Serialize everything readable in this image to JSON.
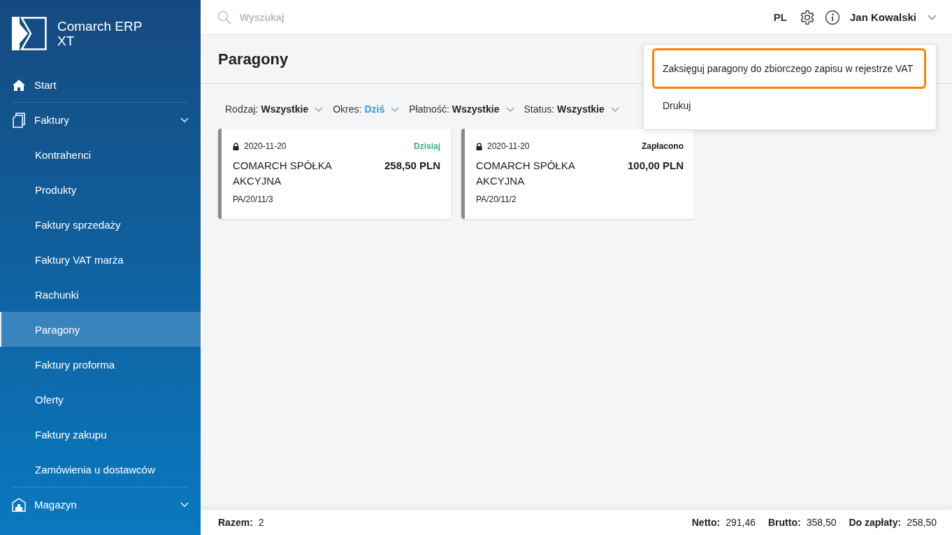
{
  "app": {
    "name_line_1": "Comarch ERP",
    "name_line_2": "XT"
  },
  "sidebar": {
    "items": [
      {
        "kind": "link",
        "label": "Start",
        "selected": false
      },
      {
        "kind": "group",
        "label": "Faktury",
        "expanded": true,
        "children": [
          {
            "label": "Kontrahenci",
            "selected": false
          },
          {
            "label": "Produkty",
            "selected": false
          },
          {
            "label": "Faktury sprzedaży",
            "selected": false
          },
          {
            "label": "Faktury VAT marża",
            "selected": false
          },
          {
            "label": "Rachunki",
            "selected": false
          },
          {
            "label": "Paragony",
            "selected": true
          },
          {
            "label": "Faktury proforma",
            "selected": false
          },
          {
            "label": "Oferty",
            "selected": false
          },
          {
            "label": "Faktury zakupu",
            "selected": false
          },
          {
            "label": "Zamówienia u dostawców",
            "selected": false
          }
        ]
      },
      {
        "kind": "group",
        "label": "Magazyn",
        "expanded": false
      }
    ]
  },
  "topbar": {
    "search": {
      "placeholder": "Wyszukaj"
    },
    "language": "PL",
    "user": "Jan Kowalski"
  },
  "page": {
    "title": "Paragony"
  },
  "filters": [
    {
      "label": "Rodzaj:",
      "value": "Wszystkie",
      "highlighted": false
    },
    {
      "label": "Okres:",
      "value": "Dziś",
      "highlighted": true
    },
    {
      "label": "Płatność:",
      "value": "Wszystkie",
      "highlighted": false
    },
    {
      "label": "Status:",
      "value": "Wszystkie",
      "highlighted": false
    }
  ],
  "receipts": [
    {
      "date": "2020-11-20",
      "status": "Dzisiaj",
      "color": "#3dae7a",
      "customer": "COMARCH SPÓŁKA AKCYJNA",
      "amount": "258,50 PLN",
      "number": "PA/20/11/3"
    },
    {
      "date": "2020-11-20",
      "status": "Zapłacono",
      "color": "#1a1a1a",
      "customer": "COMARCH SPÓŁKA AKCYJNA",
      "amount": "100,00 PLN",
      "number": "PA/20/11/2"
    }
  ],
  "actions_menu": [
    {
      "label": "Zaksięguj paragony do zbiorczego zapisu w rejestrze VAT",
      "focused": true
    },
    {
      "label": "Drukuj",
      "focused": false
    }
  ],
  "footer": {
    "count_label": "Razem:",
    "count": "2",
    "totals": [
      {
        "label": "Netto:",
        "value": "291,46"
      },
      {
        "label": "Brutto:",
        "value": "358,50"
      },
      {
        "label": "Do zapłaty:",
        "value": "258,50"
      }
    ]
  }
}
